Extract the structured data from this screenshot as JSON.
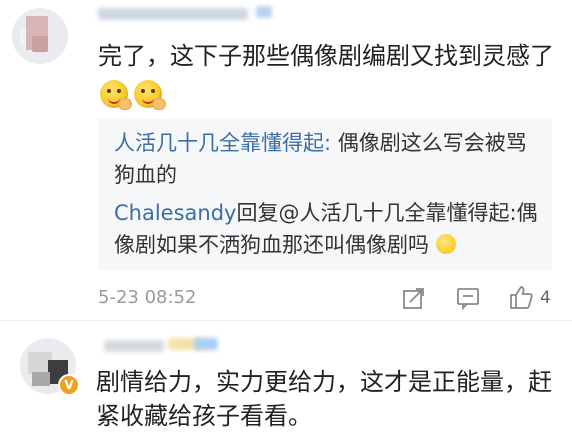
{
  "comments": [
    {
      "text": "完了，这下子那些偶像剧编剧又找到灵感了",
      "emojis": [
        "yummy-face-icon",
        "yummy-face-icon"
      ],
      "reply_thread": {
        "line1_name": "人活几十几全靠懂得起:",
        "line1_text": " 偶像剧这么写会被骂",
        "line2_text": "狗血的",
        "line3_name": "Chalesandy",
        "line3_text": "回复@人活几十几全靠懂得起:偶",
        "line4_text": "像剧如果不洒狗血那还叫偶像剧吗"
      },
      "date": "5-23 08:52",
      "actions": {
        "forward_icon": "share-box-icon",
        "comment_icon": "comment-bubble-icon",
        "like_icon": "thumbs-up-icon",
        "like_count": "4"
      }
    },
    {
      "text_line1": "剧情给力，实力更给力，这才是正能量，赶",
      "text_line2": "紧收藏给孩子看看。",
      "badge": "V"
    }
  ],
  "colors": {
    "link_blue": "#3a6ea5",
    "reply_bg": "#f6f7f9",
    "meta_gray": "#9a9a9a",
    "badge_orange": "#f0a020"
  }
}
